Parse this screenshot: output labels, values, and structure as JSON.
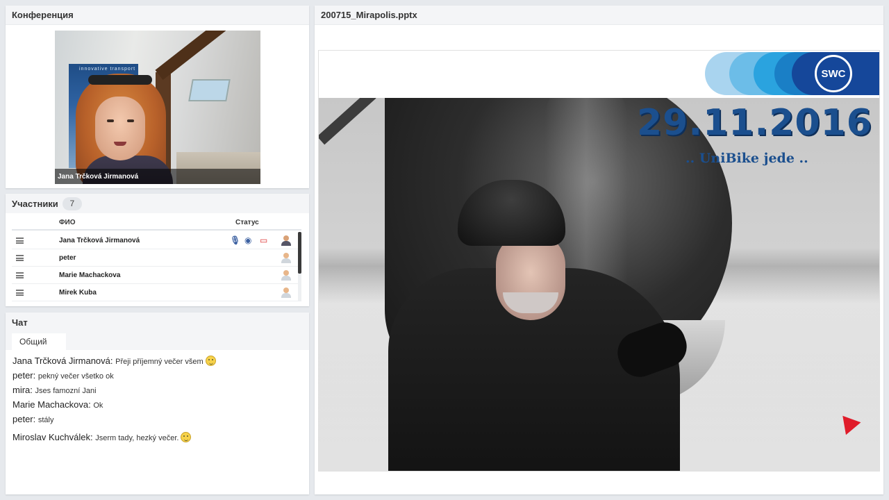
{
  "conference": {
    "title": "Конференция",
    "video_name": "Jana Trčková Jirmanová",
    "poster_text": "innovative transport"
  },
  "participants": {
    "title": "Участники",
    "count": "7",
    "col_name": "ФИО",
    "col_status": "Статус",
    "rows": [
      {
        "name": "Jana Trčková Jirmanová",
        "host": true
      },
      {
        "name": "peter",
        "host": false
      },
      {
        "name": "Marie Machackova",
        "host": false
      },
      {
        "name": "Mirek Kuba",
        "host": false
      }
    ]
  },
  "chat": {
    "title": "Чат",
    "tab": "Общий",
    "messages": [
      {
        "author": "Jana Trčková Jirmanová:",
        "text": "Přeji příjemný večer všem",
        "emoji": "smile-icon"
      },
      {
        "author": "peter:",
        "text": "pekný večer všetko ok"
      },
      {
        "author": "mira:",
        "text": "Jses famozní Jani"
      },
      {
        "author": "Marie Machackova:",
        "text": "Ok"
      },
      {
        "author": "peter:",
        "text": "stály"
      },
      {
        "author": "Miroslav Kuchválek:",
        "text": "Jserm tady, hezký večer.",
        "emoji": "grin-icon"
      }
    ]
  },
  "presentation": {
    "title": "200715_Mirapolis.pptx",
    "logo": "SWC",
    "date": "29.11.2016",
    "subtitle": ".. UniBike jede ..",
    "brand_color": "#1b4f8e"
  }
}
